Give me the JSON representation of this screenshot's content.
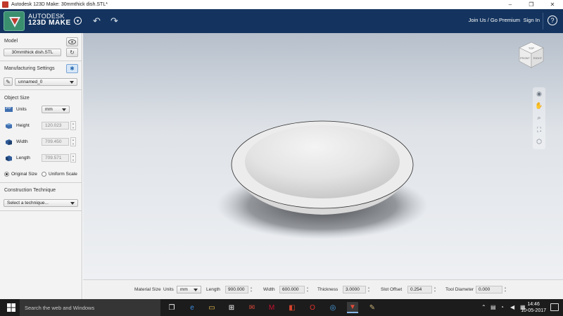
{
  "window": {
    "title": "Autodesk 123D Make: 30mmthick dish.STL*",
    "minimize": "–",
    "maximize": "❐",
    "close": "✕"
  },
  "header": {
    "brand_line1": "AUTODESK",
    "brand_line2": "123D MAKE",
    "brand_caret": "▾",
    "undo_icon": "↶",
    "redo_icon": "↷",
    "links": "Join Us / Go Premium",
    "signin": "Sign In",
    "help": "?"
  },
  "panel": {
    "model_title": "Model",
    "model_file": "30mmthick dish.STL",
    "mfg_title": "Manufacturing Settings",
    "mfg_value": "unnamed_0",
    "object_size_title": "Object Size",
    "units_label": "Units",
    "units_value": "mm",
    "height_label": "Height",
    "height_value": "120.023",
    "width_label": "Width",
    "width_value": "709.450",
    "length_label": "Length",
    "length_value": "709.571",
    "original_size": "Original Size",
    "uniform_scale": "Uniform Scale",
    "construction_title": "Construction Technique",
    "construction_value": "Select a technique..."
  },
  "navcube": {
    "top": "TOP",
    "front": "FRONT",
    "right": "RIGHT"
  },
  "bottombar": {
    "material_size": "Material Size",
    "units_label": "Units",
    "units_value": "mm",
    "length_label": "Length",
    "length_value": "900.000",
    "width_label": "Width",
    "width_value": "600.000",
    "thickness_label": "Thickness",
    "thickness_value": "3.0000",
    "slot_offset_label": "Slot Offset",
    "slot_offset_value": "0.254",
    "tool_diameter_label": "Tool Diameter",
    "tool_diameter_value": "0.000"
  },
  "taskbar": {
    "search_placeholder": "Search the web and Windows",
    "time": "14:46",
    "date": "10-05-2017"
  },
  "colors": {
    "header_bg": "#14345f",
    "taskbar_bg": "#1c1c1c",
    "viewport_top": "#b6bfcb"
  }
}
